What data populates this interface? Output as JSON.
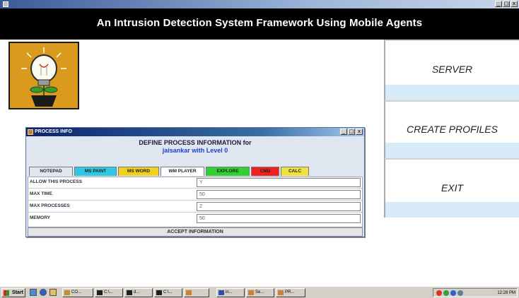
{
  "window": {
    "title": "",
    "controls": [
      "_",
      "□",
      "x"
    ]
  },
  "header": {
    "title": "An Intrusion Detection System Framework Using Mobile Agents"
  },
  "logo": {
    "icon": "lightbulb-icon"
  },
  "menu": {
    "server_label": "SERVER",
    "create_profiles_label": "CREATE PROFILES",
    "exit_label": "EXIT"
  },
  "dialog": {
    "title": "PROCESS INFO",
    "controls": [
      "_",
      "□",
      "x"
    ],
    "heading": "DEFINE PROCESS INFORMATION for",
    "subheading": "jaisankar with Level 0",
    "tabs": [
      {
        "label": "NOTEPAD",
        "color": "#dfe6f0"
      },
      {
        "label": "MS PAINT",
        "color": "#2ec8e0"
      },
      {
        "label": "MS WORD",
        "color": "#f0d020"
      },
      {
        "label": "WM PLAYER",
        "color": "#ffffff"
      },
      {
        "label": "EXPLORE",
        "color": "#30d030"
      },
      {
        "label": "CMD",
        "color": "#f02020"
      },
      {
        "label": "CALC",
        "color": "#f0e040"
      }
    ],
    "fields": [
      {
        "label": "ALLOW THIS PROCESS",
        "value": "Y"
      },
      {
        "label": "MAX TIME",
        "value": "50"
      },
      {
        "label": "MAX PROCESSES",
        "value": "2"
      },
      {
        "label": "MEMORY",
        "value": "50"
      }
    ],
    "accept_label": "ACCEPT INFORMATION"
  },
  "taskbar": {
    "start_label": "Start",
    "tasks": [
      "CO...",
      "C:\\...",
      "d...",
      "C:\\...",
      "",
      "in...",
      "Se...",
      "PR..."
    ],
    "clock": "12:28 PM"
  },
  "colors": {
    "header_bg": "#000000",
    "menu_strip": "#d6ebf7",
    "logo_bg": "#d99a1d"
  }
}
